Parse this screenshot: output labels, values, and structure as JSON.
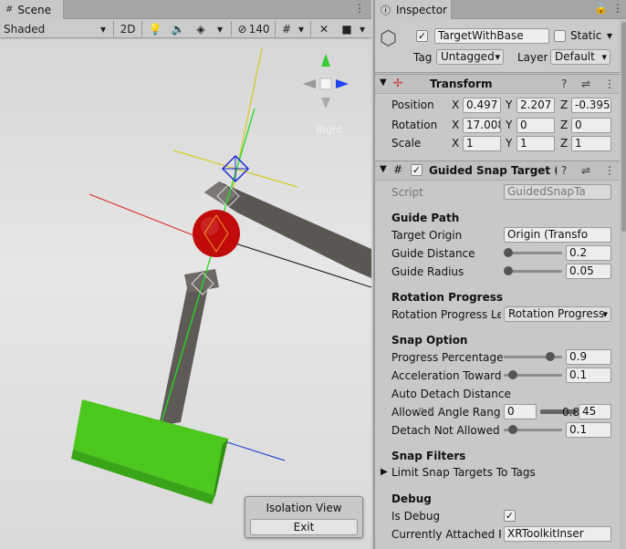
{
  "scene": {
    "tab_label": "Scene",
    "shading_mode": "Shaded",
    "toolbar_2d": "2D",
    "hidden_count": "140",
    "gizmo_label": "Right",
    "isolation_title": "Isolation View",
    "isolation_exit": "Exit"
  },
  "inspector": {
    "tab_label": "Inspector",
    "object_name": "TargetWithBase",
    "static_label": "Static",
    "tag_label": "Tag",
    "tag_value": "Untagged",
    "layer_label": "Layer",
    "layer_value": "Default",
    "transform": {
      "title": "Transform",
      "position_label": "Position",
      "rotation_label": "Rotation",
      "scale_label": "Scale",
      "x": "X",
      "y": "Y",
      "z": "Z",
      "position": [
        "0.497",
        "2.207",
        "-0.395"
      ],
      "rotation": [
        "17.008",
        "0",
        "0"
      ],
      "scale": [
        "1",
        "1",
        "1"
      ]
    },
    "guided": {
      "title": "Guided Snap Target (Sc",
      "script_label": "Script",
      "script_value": "GuidedSnapTa",
      "guide_path": "Guide Path",
      "target_origin_label": "Target Origin",
      "target_origin_value": "Origin (Transfo",
      "guide_distance_label": "Guide Distance",
      "guide_distance_value": "0.2",
      "guide_radius_label": "Guide Radius",
      "guide_radius_value": "0.05",
      "rotation_progress": "Rotation Progress",
      "rotation_progress_len_label": "Rotation Progress Len",
      "rotation_progress_len_value": "Rotation Progress",
      "snap_option": "Snap Option",
      "progress_pct_label": "Progress Percentage",
      "progress_pct_value": "0.9",
      "accel_label": "Acceleration Towards",
      "accel_value": "0.1",
      "auto_detach_label": "Auto Detach Distance",
      "allowed_angle_label": "Allowed Angle Range",
      "allowed_angle_min": "0",
      "allowed_angle_mid": "0.8",
      "allowed_angle_max": "45",
      "allowed_overlay": "0.9",
      "detach_not_allowed_label": "Detach Not Allowed I",
      "detach_not_allowed_value": "0.1",
      "snap_filters": "Snap Filters",
      "limit_snap_label": "Limit Snap Targets To Tags",
      "debug": "Debug",
      "is_debug_label": "Is Debug",
      "currently_attached_label": "Currently Attached Re",
      "currently_attached_value": "XRToolkitInser"
    }
  }
}
